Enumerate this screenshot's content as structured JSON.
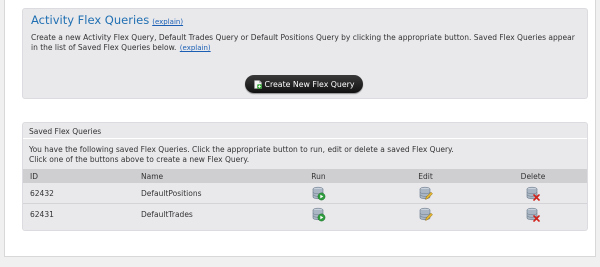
{
  "activity": {
    "title": "Activity Flex Queries",
    "explain_link": "(explain)",
    "description": "Create a new Activity Flex Query, Default Trades Query or Default Positions Query by clicking the appropriate button. Saved Flex Queries appear in the list of Saved Flex Queries below.",
    "description_link": "(explain)",
    "create_button": "Create New Flex Query"
  },
  "saved": {
    "title": "Saved Flex Queries",
    "line1": "You have the following saved Flex Queries. Click the appropriate button to run, edit or delete a saved Flex Query.",
    "line2": "Click one of the buttons above to create a new Flex Query.",
    "columns": [
      "ID",
      "Name",
      "Run",
      "Edit",
      "Delete"
    ],
    "rows": [
      {
        "id": "62432",
        "name": "DefaultPositions"
      },
      {
        "id": "62431",
        "name": "DefaultTrades"
      }
    ]
  },
  "icons": {
    "run": "database-run-icon",
    "edit": "database-edit-icon",
    "delete": "database-delete-icon",
    "create": "new-document-icon"
  },
  "colors": {
    "title": "#1f6fb2",
    "link": "#1a5fb4",
    "button": "#222222",
    "header_bg": "#cfcfd2",
    "panel_bg": "#e9e9ec"
  }
}
